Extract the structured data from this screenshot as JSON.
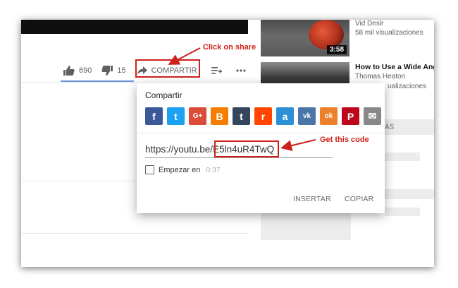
{
  "video": {
    "like_count": "690",
    "dislike_count": "15",
    "share_label": "COMPARTIR"
  },
  "annotations": {
    "share_hint": "Click on share",
    "code_hint": "Get this code"
  },
  "sidebar": {
    "items": [
      {
        "channel": "Vid Deslr",
        "views": "58 mil visualizaciones",
        "duration": "3:58"
      },
      {
        "title": "How to Use a Wide Angl",
        "channel": "Thomas Heaton",
        "views": "ualizaciones"
      }
    ],
    "tab_label": "ÁS"
  },
  "share_dialog": {
    "title": "Compartir",
    "social": [
      {
        "name": "facebook",
        "color": "#3b5998",
        "glyph": "f"
      },
      {
        "name": "twitter",
        "color": "#1da1f2",
        "glyph": "t"
      },
      {
        "name": "google-plus",
        "color": "#dd4b39",
        "glyph": "G+"
      },
      {
        "name": "blogger",
        "color": "#f57d00",
        "glyph": "B"
      },
      {
        "name": "tumblr",
        "color": "#35465c",
        "glyph": "t"
      },
      {
        "name": "reddit",
        "color": "#ff4500",
        "glyph": "r"
      },
      {
        "name": "ameba",
        "color": "#2d8fd5",
        "glyph": "a"
      },
      {
        "name": "vk",
        "color": "#4a76a8",
        "glyph": "vk"
      },
      {
        "name": "odnoklassniki",
        "color": "#ed812b",
        "glyph": "ok"
      },
      {
        "name": "pinterest",
        "color": "#bd081c",
        "glyph": "P"
      },
      {
        "name": "email",
        "color": "#888888",
        "glyph": "✉"
      }
    ],
    "url_prefix": "https://youtu.be/",
    "video_code": "E5ln4uR4TwQ",
    "start_label": "Empezar en",
    "start_time": "0:37",
    "embed_label": "INSERTAR",
    "copy_label": "COPIAR"
  },
  "colors": {
    "annotation_red": "#d0201a",
    "active_tab_blue": "#6b93d6"
  }
}
